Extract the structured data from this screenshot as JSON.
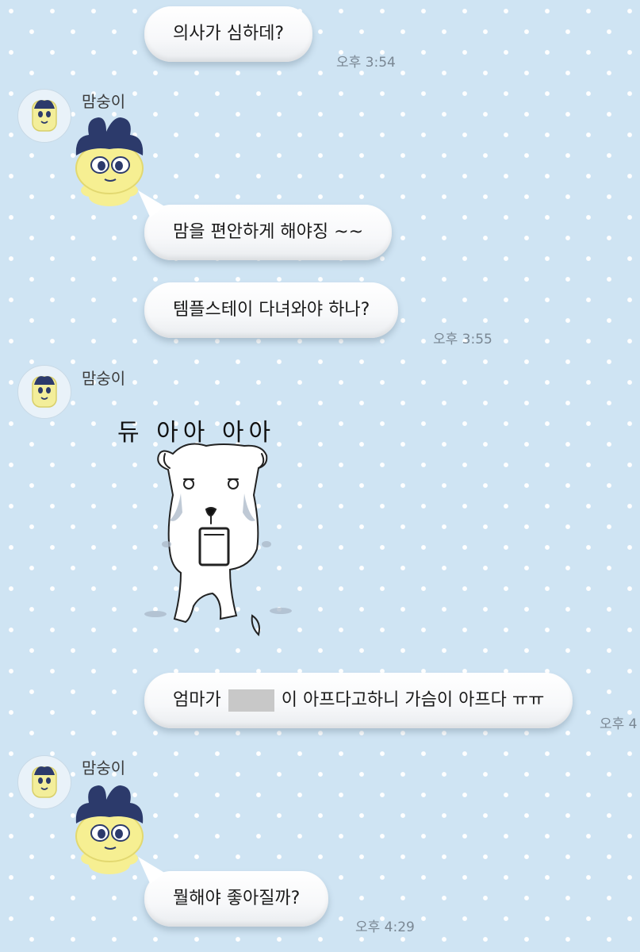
{
  "sender_name": "맘숭이",
  "messages": [
    {
      "text": "의사가 심하데?",
      "time": "오후 3:54"
    },
    {
      "text": "맘을 편안하게 해야징 ~~"
    },
    {
      "text": "템플스테이 다녀와야 하나?",
      "time": "오후 3:55"
    },
    {
      "sticker_caption": "듀 아아 아아"
    },
    {
      "text_before": "엄마가",
      "text_after": "이 아프다고하니 가슴이 아프다 ㅠㅠ",
      "time": "오후 4"
    },
    {
      "text": "뭘해야 좋아질까?",
      "time": "오후 4:29"
    }
  ],
  "colors": {
    "background": "#cfe4f3",
    "dots": "#ffffff",
    "bubble": "#ffffff",
    "timestamp": "#7a8793",
    "mascot_body": "#f3ee9a",
    "mascot_hat": "#2c3a6b"
  },
  "icons": [
    "mascot-avatar-icon",
    "mascot-sticker-icon",
    "crying-dog-sticker"
  ]
}
